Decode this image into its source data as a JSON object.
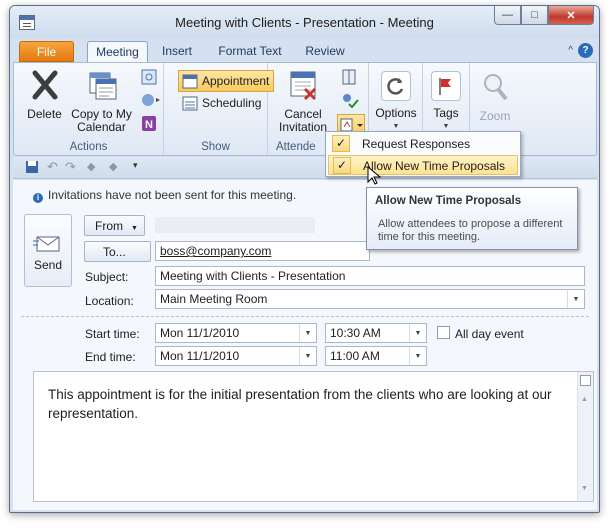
{
  "window": {
    "title": "Meeting with Clients - Presentation  -  Meeting",
    "min": "—",
    "max": "□",
    "close": "✕"
  },
  "tabs": [
    {
      "label": "File"
    },
    {
      "label": "Meeting"
    },
    {
      "label": "Insert"
    },
    {
      "label": "Format Text"
    },
    {
      "label": "Review"
    }
  ],
  "ribbon": {
    "actions": {
      "label": "Actions",
      "delete": "Delete",
      "copy_line1": "Copy to My",
      "copy_line2": "Calendar"
    },
    "show": {
      "label": "Show",
      "appointment": "Appointment",
      "scheduling": "Scheduling"
    },
    "attendees": {
      "label": "Attende",
      "cancel_line1": "Cancel",
      "cancel_line2": "Invitation"
    },
    "options": "Options",
    "tags": "Tags",
    "zoom": "Zoom"
  },
  "info": "Invitations have not been sent for this meeting.",
  "form": {
    "send": "Send",
    "from": "From",
    "to": "To...",
    "to_value": "boss@company.com",
    "subject_label": "Subject:",
    "subject_value": "Meeting with Clients - Presentation",
    "location_label": "Location:",
    "location_value": "Main Meeting Room",
    "start_label": "Start time:",
    "start_date": "Mon 11/1/2010",
    "start_time": "10:30 AM",
    "end_label": "End time:",
    "end_date": "Mon 11/1/2010",
    "end_time": "11:00 AM",
    "all_day": "All day event"
  },
  "body_text": "This appointment is for the initial presentation from the clients who are looking at our representation.",
  "menu": {
    "item1": "Request Responses",
    "item2": "Allow New Time Proposals",
    "check": "✓"
  },
  "tooltip": {
    "title": "Allow New Time Proposals",
    "desc": "Allow attendees to propose a different time for this meeting."
  },
  "colors": {
    "file_tab": "#e4780e",
    "accent": "#2c6bb5",
    "menu_hover": "#ffe28f"
  }
}
